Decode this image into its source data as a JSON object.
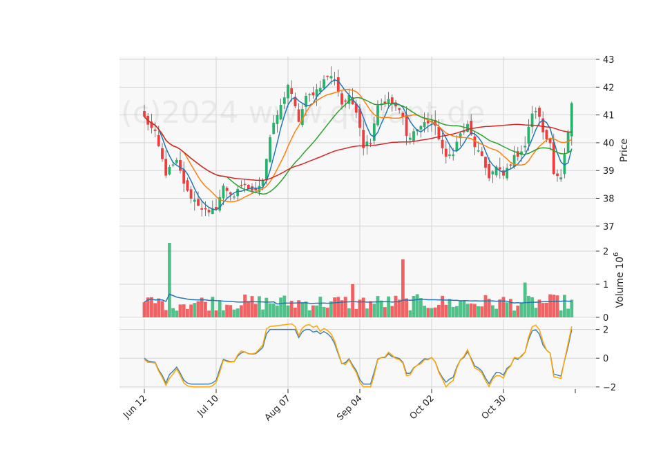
{
  "chart_data": {
    "type": "candlestick",
    "watermark": "(c)2024 www.qquant.de",
    "colors": {
      "up": "#26b36b",
      "down": "#f03c3c",
      "ma_short": "#1f77b4",
      "ma_medium": "#ff7f0e",
      "ma_long": "#2ca02c",
      "ma_xlong": "#d62728",
      "volume_ma": "#1f77b4",
      "osc_a": "#4682b4",
      "osc_b": "#ffa500",
      "panel_bg": "#f8f8f8",
      "grid": "#d4d4d4"
    },
    "x_tick_labels": [
      "Jun 12",
      "Jul 10",
      "Aug 07",
      "Sep 04",
      "Oct 02",
      "Oct 30"
    ],
    "x_tick_indices": [
      0,
      20,
      40,
      60,
      80,
      100
    ],
    "n_bars": 120,
    "price_panel": {
      "ylabel": "Price",
      "ylim": [
        36.4,
        43.1
      ],
      "yticks": [
        37,
        38,
        39,
        40,
        41,
        42,
        43
      ],
      "keypoints": [
        [
          0,
          40.9
        ],
        [
          3,
          40.3
        ],
        [
          6,
          38.9
        ],
        [
          9,
          39.3
        ],
        [
          12,
          38.2
        ],
        [
          15,
          37.8
        ],
        [
          18,
          37.4
        ],
        [
          20,
          37.7
        ],
        [
          22,
          38.4
        ],
        [
          25,
          38.1
        ],
        [
          28,
          38.5
        ],
        [
          30,
          38.2
        ],
        [
          33,
          38.7
        ],
        [
          35,
          40.2
        ],
        [
          37,
          41.0
        ],
        [
          38,
          41.3
        ],
        [
          40,
          42.1
        ],
        [
          43,
          40.8
        ],
        [
          45,
          41.6
        ],
        [
          48,
          41.9
        ],
        [
          51,
          42.4
        ],
        [
          53,
          42.3
        ],
        [
          55,
          41.4
        ],
        [
          57,
          41.6
        ],
        [
          59,
          41.2
        ],
        [
          60,
          40.6
        ],
        [
          61,
          39.9
        ],
        [
          63,
          40.1
        ],
        [
          65,
          41.4
        ],
        [
          68,
          41.5
        ],
        [
          70,
          41.3
        ],
        [
          72,
          40.9
        ],
        [
          73,
          40.2
        ],
        [
          75,
          40.4
        ],
        [
          78,
          40.7
        ],
        [
          80,
          40.8
        ],
        [
          82,
          40.2
        ],
        [
          84,
          39.4
        ],
        [
          86,
          39.7
        ],
        [
          88,
          40.3
        ],
        [
          90,
          40.6
        ],
        [
          92,
          39.9
        ],
        [
          94,
          39.4
        ],
        [
          96,
          38.8
        ],
        [
          98,
          39.1
        ],
        [
          100,
          38.8
        ],
        [
          102,
          39.3
        ],
        [
          104,
          39.6
        ],
        [
          106,
          39.9
        ],
        [
          108,
          41.1
        ],
        [
          110,
          41.0
        ],
        [
          111,
          40.3
        ],
        [
          113,
          40.0
        ],
        [
          114,
          39.0
        ],
        [
          116,
          38.7
        ],
        [
          118,
          40.3
        ],
        [
          119,
          41.3
        ]
      ]
    },
    "volume_panel": {
      "ylabel": "Volume  10",
      "ylabel_exponent": "6",
      "ylim": [
        0,
        2.25
      ],
      "yticks": [
        0,
        1,
        2
      ],
      "spikes": [
        [
          7,
          2.25
        ],
        [
          58,
          1.0
        ],
        [
          72,
          1.75
        ],
        [
          106,
          1.05
        ]
      ]
    },
    "oscillator_panel": {
      "ylim": [
        -2.15,
        2.75
      ],
      "yticks": [
        -2,
        0,
        2
      ]
    }
  }
}
